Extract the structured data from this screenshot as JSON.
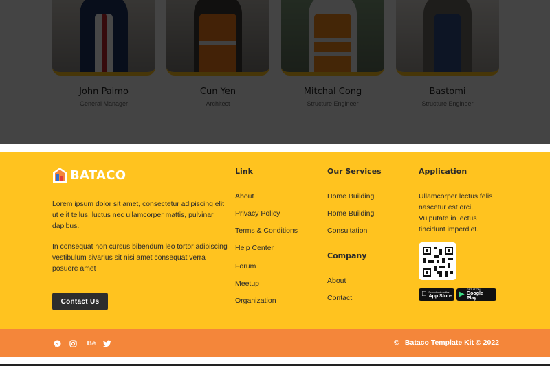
{
  "team": {
    "members": [
      {
        "name": "John Paimo",
        "role": "General Manager"
      },
      {
        "name": "Cun Yen",
        "role": "Architect"
      },
      {
        "name": "Mitchal Cong",
        "role": "Structure Engineer"
      },
      {
        "name": "Bastomi",
        "role": "Structure Engineer"
      }
    ]
  },
  "footer": {
    "brand": "BATACO",
    "about": [
      "Lorem ipsum dolor sit amet, consectetur adipiscing elit ut elit tellus, luctus nec ullamcorper mattis, pulvinar dapibus.",
      "In consequat non cursus bibendum leo tortor adipiscing vestibulum sivarius sit nisi amet consequat verra posuere amet"
    ],
    "contact_label": "Contact Us",
    "link": {
      "heading": "Link",
      "items": [
        "About",
        "Privacy Policy",
        "Terms & Conditions",
        "Help Center",
        "Forum",
        "Meetup",
        "Organization"
      ]
    },
    "services": {
      "heading": "Our Services",
      "items": [
        "Home Building",
        "Home Building",
        "Consultation"
      ]
    },
    "company": {
      "heading": "Company",
      "items": [
        "About",
        "Contact"
      ]
    },
    "application": {
      "heading": "Application",
      "text": "Ullamcorper lectus felis nascetur est orci. Vulputate in lectus tincidunt imperdiet.",
      "app_store": {
        "small": "Download on the",
        "large": "App Store"
      },
      "google_play": {
        "small": "GET IT ON",
        "large": "Google Play"
      }
    }
  },
  "bottom": {
    "social_icons": [
      "messenger-icon",
      "instagram-icon",
      "behance-icon",
      "twitter-icon"
    ],
    "behance_glyph": "Bē",
    "copyright_symbol": "©",
    "copyright": "Bataco Template Kit © 2022"
  },
  "colors": {
    "footer_bg": "#ffc31f",
    "bottom_bar_bg": "#f4863a",
    "button_bg": "#2d2d2d",
    "accent": "#ffc31f"
  }
}
